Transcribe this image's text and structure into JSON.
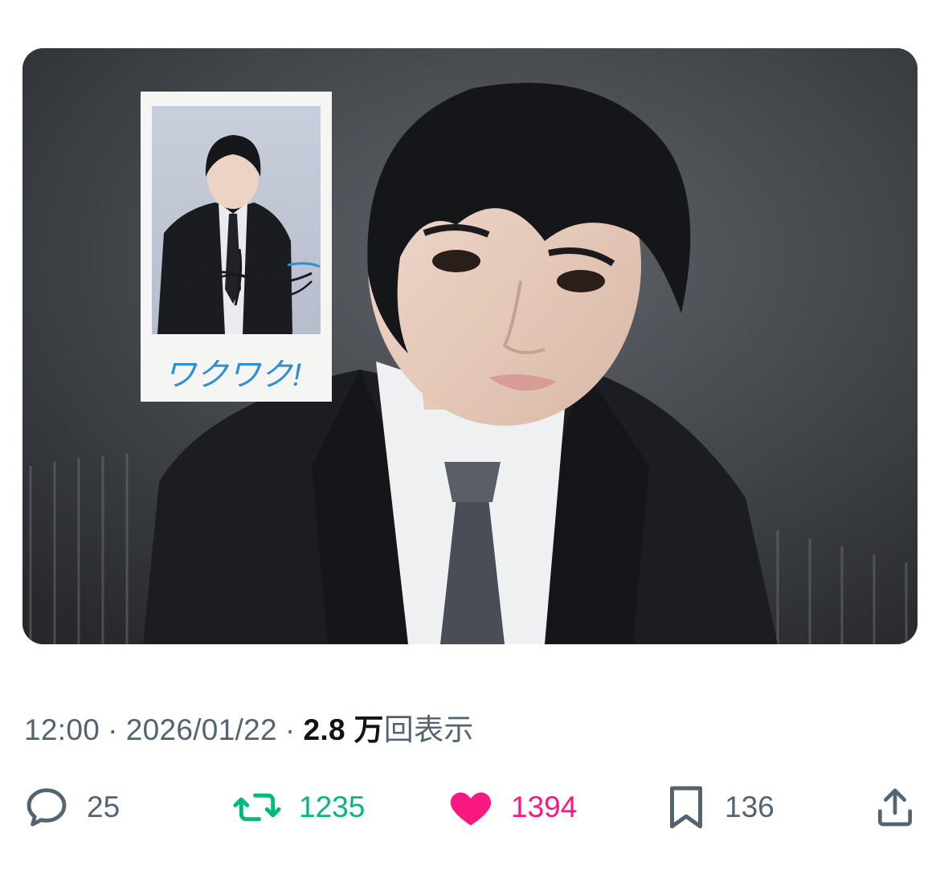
{
  "post": {
    "media": {
      "polaroid_caption": "ワクワク!",
      "polaroid_signature": "signature"
    },
    "meta": {
      "time": "12:00",
      "separator": "·",
      "date": "2026/01/22",
      "views_number": "2.8",
      "views_unit": "万",
      "views_label": "回表示"
    },
    "actions": {
      "reply_count": "25",
      "retweet_count": "1235",
      "like_count": "1394",
      "bookmark_count": "136"
    },
    "colors": {
      "retweet": "#00ba7c",
      "like": "#f91880",
      "muted": "#536471"
    }
  }
}
